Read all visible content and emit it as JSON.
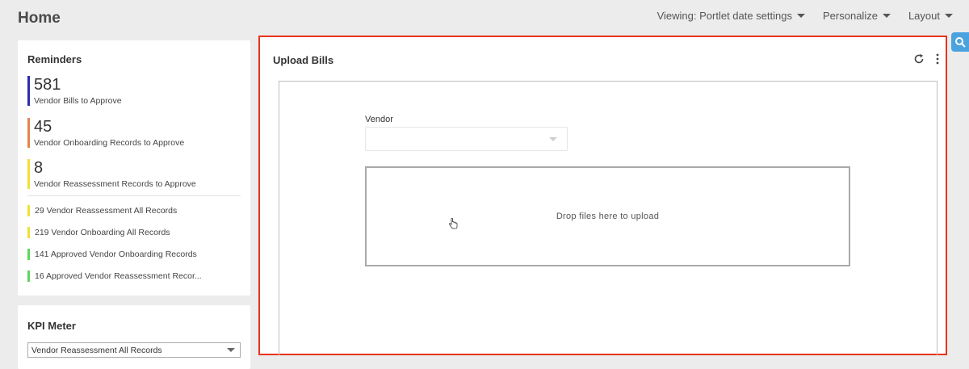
{
  "header": {
    "title": "Home",
    "menu": [
      {
        "label": "Viewing: Portlet date settings"
      },
      {
        "label": "Personalize"
      },
      {
        "label": "Layout"
      }
    ]
  },
  "reminders": {
    "title": "Reminders",
    "big_items": [
      {
        "count": "581",
        "label": "Vendor Bills to Approve",
        "color": "#2b2bb0"
      },
      {
        "count": "45",
        "label": "Vendor Onboarding Records to Approve",
        "color": "#e0874a"
      },
      {
        "count": "8",
        "label": "Vendor Reassessment Records to Approve",
        "color": "#f0df3a"
      }
    ],
    "small_items": [
      {
        "text": "29  Vendor Reassessment All Records",
        "color": "#f0df3a"
      },
      {
        "text": "219  Vendor Onboarding All Records",
        "color": "#f0df3a"
      },
      {
        "text": "141  Approved Vendor Onboarding Records",
        "color": "#5cd65c"
      },
      {
        "text": "16  Approved Vendor Reassessment Recor...",
        "color": "#5cd65c"
      }
    ]
  },
  "kpi": {
    "title": "KPI Meter",
    "selected": "Vendor Reassessment All Records"
  },
  "upload": {
    "title": "Upload Bills",
    "vendor_label": "Vendor",
    "vendor_value": "",
    "drop_text": "Drop files here to upload",
    "highlight_color": "#e8341c"
  }
}
